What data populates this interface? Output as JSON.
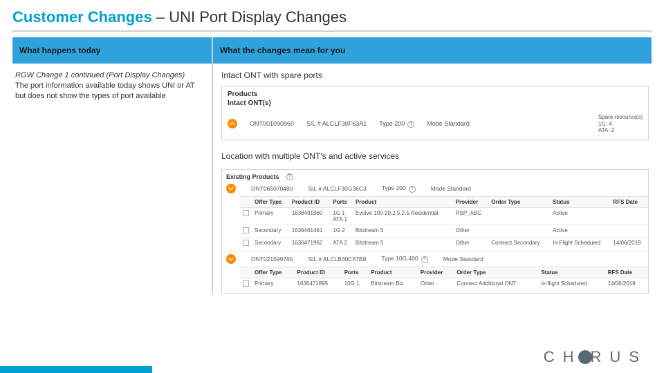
{
  "title": {
    "main": "Customer Changes",
    "dash": " – ",
    "sub": "UNI Port Display Changes"
  },
  "headers": {
    "left": "What happens today",
    "right": "What the changes mean for you"
  },
  "left_body": {
    "heading": "RGW Change 1 continued (Port Display Changes)",
    "text": "The port information available today shows UNI or AT but does not show the types of port available"
  },
  "section1": {
    "title": "Intact ONT with spare ports"
  },
  "panel1": {
    "products_label": "Products",
    "sub_label": "Intact ONT(s)",
    "ont": {
      "id": "ONT001090960",
      "serial": "S/L # ALCLF30F63A1",
      "type": "Type 200",
      "mode": "Mode Standard",
      "spare_label": "Spare resource(s)",
      "spare_1g": "1G: 4",
      "spare_ata": "ATA: 2"
    }
  },
  "section2": {
    "title": "Location with multiple ONT's and active services"
  },
  "panel2": {
    "existing_label": "Existing Products",
    "ont_a": {
      "id": "ONT065070480",
      "serial": "S/L # ALCLF30G36C3",
      "type": "Type 200",
      "mode": "Mode Standard"
    },
    "cols": {
      "offer": "Offer Type",
      "pid": "Product ID",
      "ports": "Ports",
      "product": "Product",
      "provider": "Provider",
      "otype": "Order Type",
      "status": "Status",
      "rfs": "RFS Date"
    },
    "rows_a": [
      {
        "offer": "Primary",
        "pid": "1638491960",
        "ports1": "1G 1",
        "ports2": "ATA 1",
        "product": "Evolve 100-20,2.5,2.5 Residential",
        "provider": "RSP_ABC",
        "otype": "",
        "status": "Active",
        "rfs": ""
      },
      {
        "offer": "Secondary",
        "pid": "1639461461",
        "ports1": "1G 2",
        "ports2": "",
        "product": "Bitstream 5",
        "provider": "Other",
        "otype": "",
        "status": "Active",
        "rfs": ""
      },
      {
        "offer": "Secondary",
        "pid": "1636471962",
        "ports1": "ATA 2",
        "ports2": "",
        "product": "Bitstream 5",
        "provider": "Other",
        "otype": "Connect Secondary",
        "status": "In-Flight Scheduled",
        "rfs": "14/06/2019"
      }
    ],
    "ont_b": {
      "id": "ONT021599765",
      "serial": "S/L # ALCLB30C67B8",
      "type": "Type 10G.400",
      "mode": "Mode Standard"
    },
    "rows_b": [
      {
        "offer": "Primary",
        "pid": "1636471895",
        "ports1": "10G 1",
        "ports2": "",
        "product": "Bitstream Biz",
        "provider": "Other",
        "otype": "Connect Additional ONT",
        "status": "In-flight Scheduled",
        "rfs": "14/06/2019"
      }
    ]
  },
  "logo": {
    "c": "C",
    "h": "H",
    "r": "R",
    "u": "U",
    "s": "S"
  }
}
